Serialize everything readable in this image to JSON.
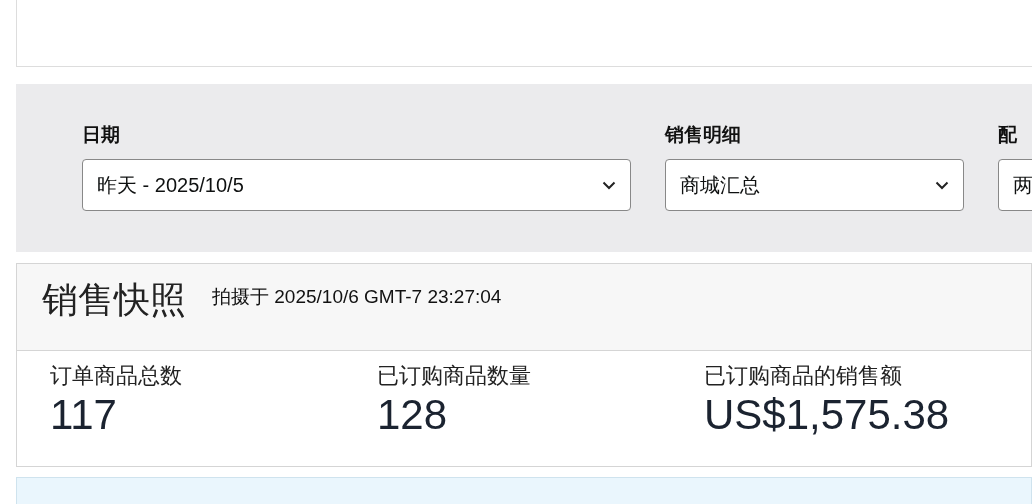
{
  "filters": [
    {
      "label": "日期",
      "value": "昨天 - 2025/10/5"
    },
    {
      "label": "销售明细",
      "value": "商城汇总"
    },
    {
      "label": "配",
      "value": "两"
    }
  ],
  "snapshot": {
    "title": "销售快照",
    "subtitle": "拍摄于 2025/10/6 GMT-7 23:27:04",
    "metrics": [
      {
        "label": "订单商品总数",
        "value": "117"
      },
      {
        "label": "已订购商品数量",
        "value": "128"
      },
      {
        "label": "已订购商品的销售额",
        "value": "US$1,575.38"
      }
    ]
  }
}
